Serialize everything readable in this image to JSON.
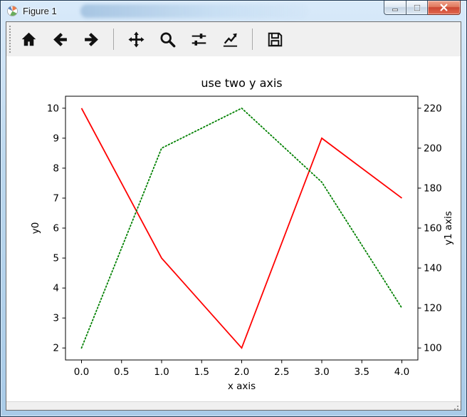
{
  "window": {
    "title": "Figure 1",
    "controls": [
      {
        "name": "minimize"
      },
      {
        "name": "maximize"
      },
      {
        "name": "close"
      }
    ]
  },
  "toolbar": {
    "groups": [
      [
        "home",
        "back",
        "forward"
      ],
      [
        "pan",
        "zoom",
        "configure-subplots",
        "edit-parameters"
      ],
      [
        "save"
      ]
    ]
  },
  "statusbar": {
    "message": ""
  },
  "chart_data": {
    "type": "line",
    "title": "use two y axis",
    "xlabel": "x axis",
    "ylabel_left": "y0",
    "ylabel_right": "y1 axis",
    "x": [
      0,
      1,
      2,
      3,
      4
    ],
    "series": [
      {
        "name": "y0",
        "axis": "left",
        "color": "#ff0000",
        "style": "solid",
        "values": [
          10,
          5,
          2,
          9,
          7
        ]
      },
      {
        "name": "y1",
        "axis": "right",
        "color": "#008000",
        "style": "dotted",
        "values": [
          100,
          200,
          220,
          183,
          120
        ]
      }
    ],
    "x_ticks": [
      0,
      0.5,
      1,
      1.5,
      2,
      2.5,
      3,
      3.5,
      4
    ],
    "x_tick_labels": [
      "0.0",
      "0.5",
      "1.0",
      "1.5",
      "2.0",
      "2.5",
      "3.0",
      "3.5",
      "4.0"
    ],
    "y_ticks_left": [
      2,
      3,
      4,
      5,
      6,
      7,
      8,
      9,
      10
    ],
    "y_tick_labels_left": [
      "2",
      "3",
      "4",
      "5",
      "6",
      "7",
      "8",
      "9",
      "10"
    ],
    "y_ticks_right": [
      100,
      120,
      140,
      160,
      180,
      200,
      220
    ],
    "y_tick_labels_right": [
      "100",
      "120",
      "140",
      "160",
      "180",
      "200",
      "220"
    ],
    "xlim": [
      -0.2,
      4.2
    ],
    "ylim_left": [
      1.6,
      10.4
    ],
    "ylim_right": [
      94,
      226
    ],
    "grid": false,
    "legend": "none",
    "background": "#ffffff"
  }
}
